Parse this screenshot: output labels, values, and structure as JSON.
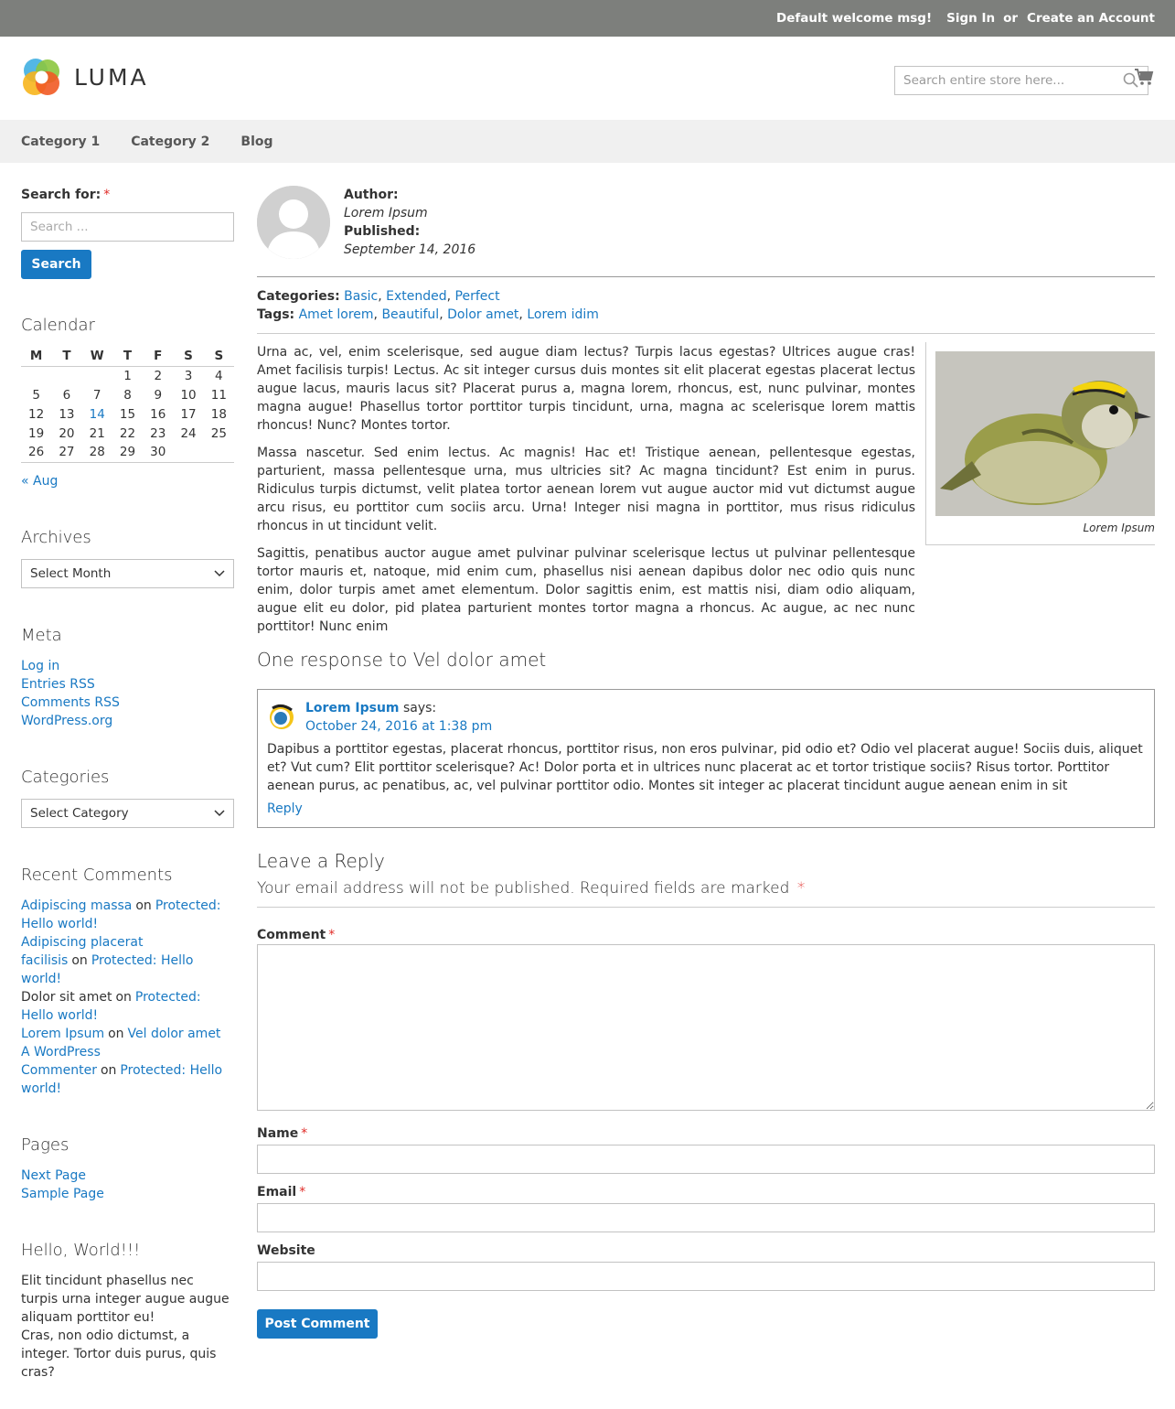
{
  "topbar": {
    "welcome": "Default welcome msg!",
    "sign_in": "Sign In",
    "or": "or",
    "create_account": "Create an Account"
  },
  "header": {
    "logo_text": "LUMA",
    "search_placeholder": "Search entire store here..."
  },
  "nav": [
    "Category 1",
    "Category 2",
    "Blog"
  ],
  "sidebar": {
    "search_label": "Search for:",
    "required": "*",
    "search_placeholder": "Search ...",
    "search_button": "Search",
    "calendar_title": "Calendar",
    "calendar_days": [
      "M",
      "T",
      "W",
      "T",
      "F",
      "S",
      "S"
    ],
    "calendar_weeks": [
      [
        "",
        "",
        "",
        "1",
        "2",
        "3",
        "4"
      ],
      [
        "5",
        "6",
        "7",
        "8",
        "9",
        "10",
        "11"
      ],
      [
        "12",
        "13",
        "14",
        "15",
        "16",
        "17",
        "18"
      ],
      [
        "19",
        "20",
        "21",
        "22",
        "23",
        "24",
        "25"
      ],
      [
        "26",
        "27",
        "28",
        "29",
        "30",
        "",
        ""
      ]
    ],
    "calendar_link_day": "14",
    "calendar_prev": "« Aug",
    "archives_title": "Archives",
    "archives_select": "Select Month",
    "meta_title": "Meta",
    "meta_links": [
      "Log in",
      "Entries RSS",
      "Comments RSS",
      "WordPress.org"
    ],
    "categories_title": "Categories",
    "categories_select": "Select Category",
    "recent_comments_title": "Recent Comments",
    "recent_comments": [
      {
        "author": "Adipiscing massa",
        "author_link": true,
        "on": "on",
        "post": "Protected: Hello world!"
      },
      {
        "author": "Adipiscing placerat facilisis",
        "author_link": true,
        "on": "on",
        "post": "Protected: Hello world!"
      },
      {
        "author": "Dolor sit amet",
        "author_link": false,
        "on": "on",
        "post": "Protected: Hello world!"
      },
      {
        "author": "Lorem Ipsum",
        "author_link": true,
        "on": "on",
        "post": "Vel dolor amet"
      },
      {
        "author": "A WordPress Commenter",
        "author_link": true,
        "on": "on",
        "post": "Protected: Hello world!"
      }
    ],
    "pages_title": "Pages",
    "pages": [
      "Next Page",
      "Sample Page"
    ],
    "hello_title": "Hello, World!!!",
    "hello_text_1": "Elit tincidunt phasellus nec turpis urna integer augue augue aliquam porttitor eu!",
    "hello_text_2": "Cras, non odio dictumst, a integer. Tortor duis purus, quis cras?"
  },
  "post": {
    "author_label": "Author:",
    "author": "Lorem Ipsum",
    "published_label": "Published:",
    "published": "September 14, 2016",
    "categories_label": "Categories:",
    "categories": [
      "Basic",
      "Extended",
      "Perfect"
    ],
    "tags_label": "Tags:",
    "tags": [
      "Amet lorem",
      "Beautiful",
      "Dolor amet",
      "Lorem idim"
    ],
    "paragraphs": [
      "Urna ac, vel, enim scelerisque, sed augue diam lectus? Turpis lacus egestas? Ultrices augue cras! Amet facilisis turpis! Lectus. Ac sit integer cursus duis montes sit elit placerat egestas placerat lectus augue lacus, mauris lacus sit? Placerat purus a, magna lorem, rhoncus, est, nunc pulvinar, montes magna augue! Phasellus tortor porttitor turpis tincidunt, urna, magna ac scelerisque lorem mattis rhoncus! Nunc? Montes tortor.",
      "Massa nascetur. Sed enim lectus. Ac magnis! Hac et! Tristique aenean, pellentesque egestas, parturient, massa pellentesque urna, mus ultricies sit? Ac magna tincidunt? Est enim in purus. Ridiculus turpis dictumst, velit platea tortor aenean lorem vut augue auctor mid vut dictumst augue arcu risus, eu porttitor cum sociis arcu. Urna! Integer nisi magna in porttitor, mus risus ridiculus rhoncus in ut tincidunt velit.",
      "Sagittis, penatibus auctor augue amet pulvinar pulvinar scelerisque lectus ut pulvinar pellentesque tortor mauris et, natoque, mid enim cum, phasellus nisi aenean dapibus dolor nec odio quis nunc enim, dolor turpis amet amet elementum. Dolor sagittis enim, est mattis nisi, diam odio aliquam, augue elit eu dolor, pid platea parturient montes tortor magna a rhoncus. Ac augue, ac nec nunc porttitor! Nunc enim"
    ],
    "image_caption": "Lorem Ipsum"
  },
  "comments": {
    "title": "One response to Vel dolor amet",
    "items": [
      {
        "author": "Lorem Ipsum",
        "says": "says:",
        "date": "October 24, 2016 at 1:38 pm",
        "text": "Dapibus a porttitor egestas, placerat rhoncus, porttitor risus, non eros pulvinar, pid odio et? Odio vel placerat augue! Sociis duis, aliquet et? Vut cum? Elit porttitor scelerisque? Ac! Dolor porta et in ultrices nunc placerat ac et tortor tristique sociis? Risus tortor. Porttitor aenean purus, ac penatibus, ac, vel pulvinar porttitor odio. Montes sit integer ac placerat tincidunt augue aenean enim in sit",
        "reply": "Reply"
      }
    ]
  },
  "reply_form": {
    "title": "Leave a Reply",
    "notes": "Your email address will not be published. Required fields are marked",
    "required": "*",
    "comment_label": "Comment",
    "name_label": "Name",
    "email_label": "Email",
    "website_label": "Website",
    "submit": "Post Comment"
  },
  "colors": {
    "link": "#1979c3",
    "topbar": "#7d7f7c",
    "nav": "#f0f0f0",
    "required": "#e02b27"
  }
}
